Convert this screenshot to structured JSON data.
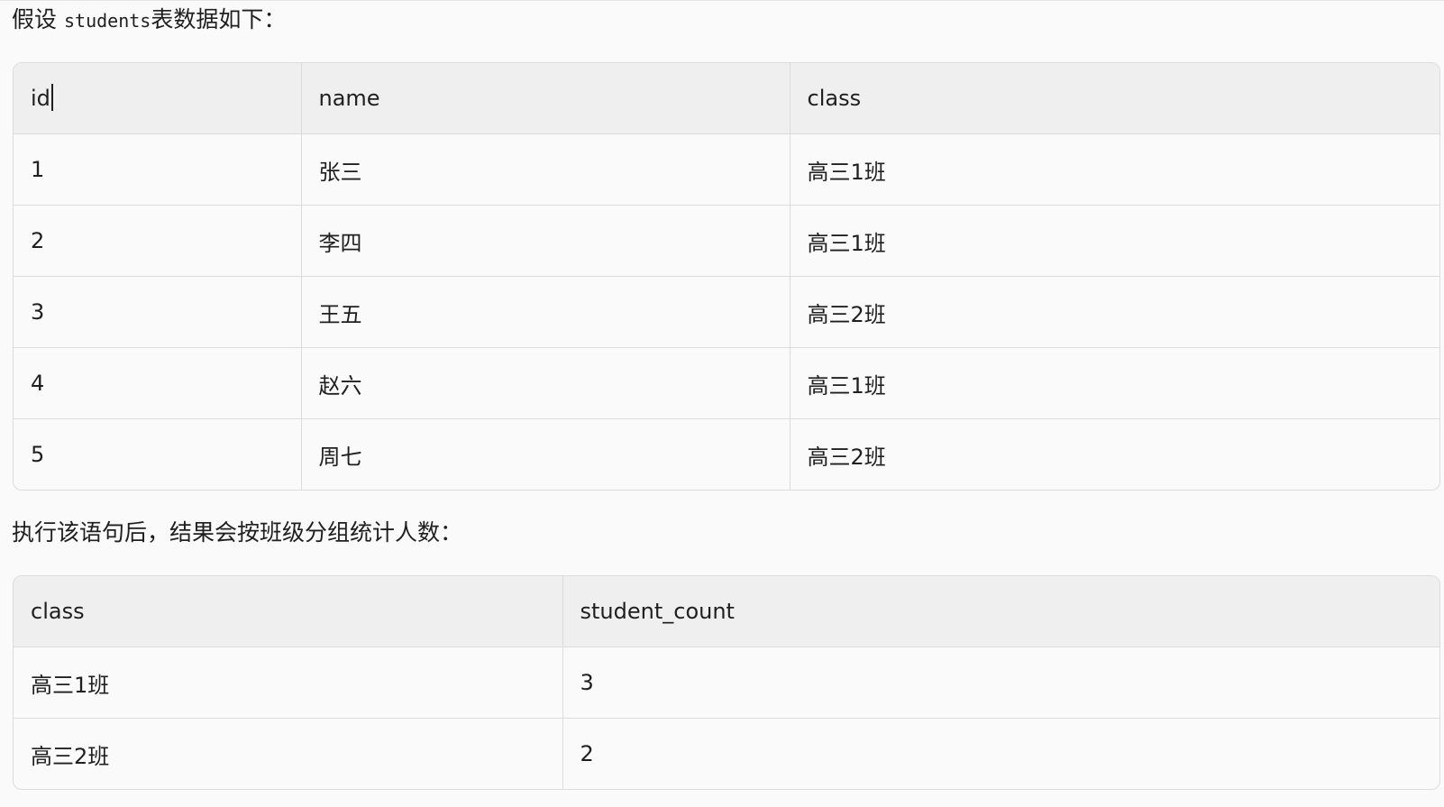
{
  "intro": {
    "prefix": "假设",
    "code": "students",
    "suffix": "表数据如下："
  },
  "students_table": {
    "headers": [
      "id",
      "name",
      "class"
    ],
    "rows": [
      [
        "1",
        "张三",
        "高三1班"
      ],
      [
        "2",
        "李四",
        "高三1班"
      ],
      [
        "3",
        "王五",
        "高三2班"
      ],
      [
        "4",
        "赵六",
        "高三1班"
      ],
      [
        "5",
        "周七",
        "高三2班"
      ]
    ]
  },
  "result_intro": "执行该语句后，结果会按班级分组统计人数：",
  "result_table": {
    "headers": [
      "class",
      "student_count"
    ],
    "rows": [
      [
        "高三1班",
        "3"
      ],
      [
        "高三2班",
        "2"
      ]
    ]
  }
}
